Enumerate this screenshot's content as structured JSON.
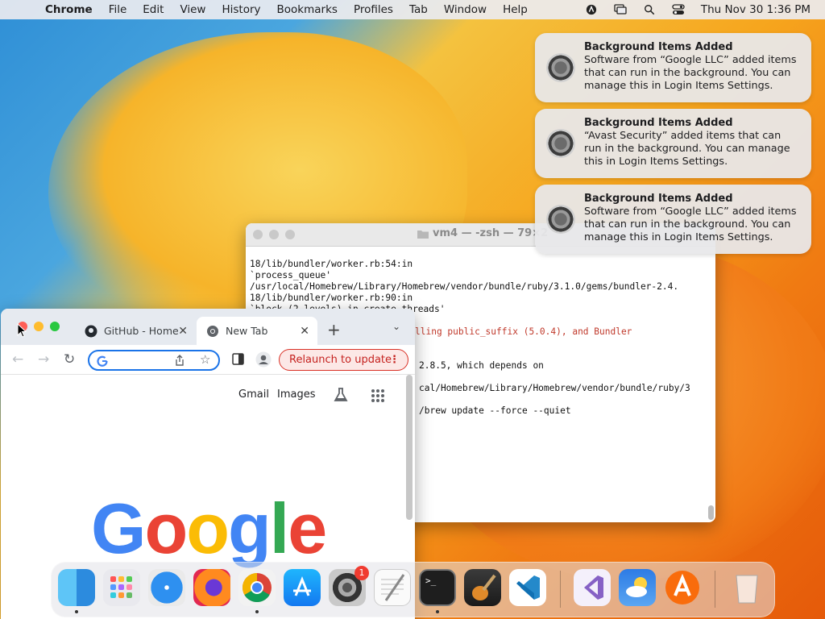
{
  "menubar": {
    "app_name": "Chrome",
    "items": [
      "File",
      "Edit",
      "View",
      "History",
      "Bookmarks",
      "Profiles",
      "Tab",
      "Window",
      "Help"
    ],
    "datetime": "Thu Nov 30  1:36 PM"
  },
  "notifications": [
    {
      "title": "Background Items Added",
      "body": "Software from “Google LLC” added items that can run in the background. You can manage this in Login Items Settings."
    },
    {
      "title": "Background Items Added",
      "body": "“Avast Security” added items that can run in the background. You can manage this in Login Items Settings."
    },
    {
      "title": "Background Items Added",
      "body": "Software from “Google LLC” added items that can run in the background. You can manage this in Login Items Settings."
    }
  ],
  "terminal": {
    "title": "vm4 — -zsh — 79×2",
    "lines": [
      "18/lib/bundler/worker.rb:54:in",
      "`process_queue'",
      "/usr/local/Homebrew/Library/Homebrew/vendor/bundle/ruby/3.1.0/gems/bundler-2.4.",
      "18/lib/bundler/worker.rb:90:in",
      "`block (2 levels) in create_threads'",
      "",
      "lling public_suffix (5.0.4), and Bundler",
      "",
      "",
      "2.8.5, which depends on",
      "",
      "cal/Homebrew/Library/Homebrew/vendor/bundle/ruby/3",
      "",
      "/brew update --force --quiet"
    ]
  },
  "chrome": {
    "tabs": [
      {
        "label": "GitHub - Home"
      },
      {
        "label": "New Tab"
      }
    ],
    "relaunch_label": "Relaunch to update",
    "links": {
      "gmail": "Gmail",
      "images": "Images"
    },
    "logo": {
      "letters": [
        "G",
        "o",
        "o",
        "g",
        "l",
        "e"
      ],
      "colors": [
        "#4285f4",
        "#ea4335",
        "#fbbc05",
        "#4285f4",
        "#34a853",
        "#ea4335"
      ]
    }
  },
  "dock": {
    "apps": [
      "Finder",
      "Launchpad",
      "Safari",
      "Firefox",
      "Chrome",
      "App Store",
      "System Settings",
      "TextEdit",
      "Terminal",
      "GarageBand",
      "Visual Studio Code",
      "Visual Studio",
      "Weather",
      "Avast Security",
      "Trash"
    ],
    "badge_count": "1"
  }
}
